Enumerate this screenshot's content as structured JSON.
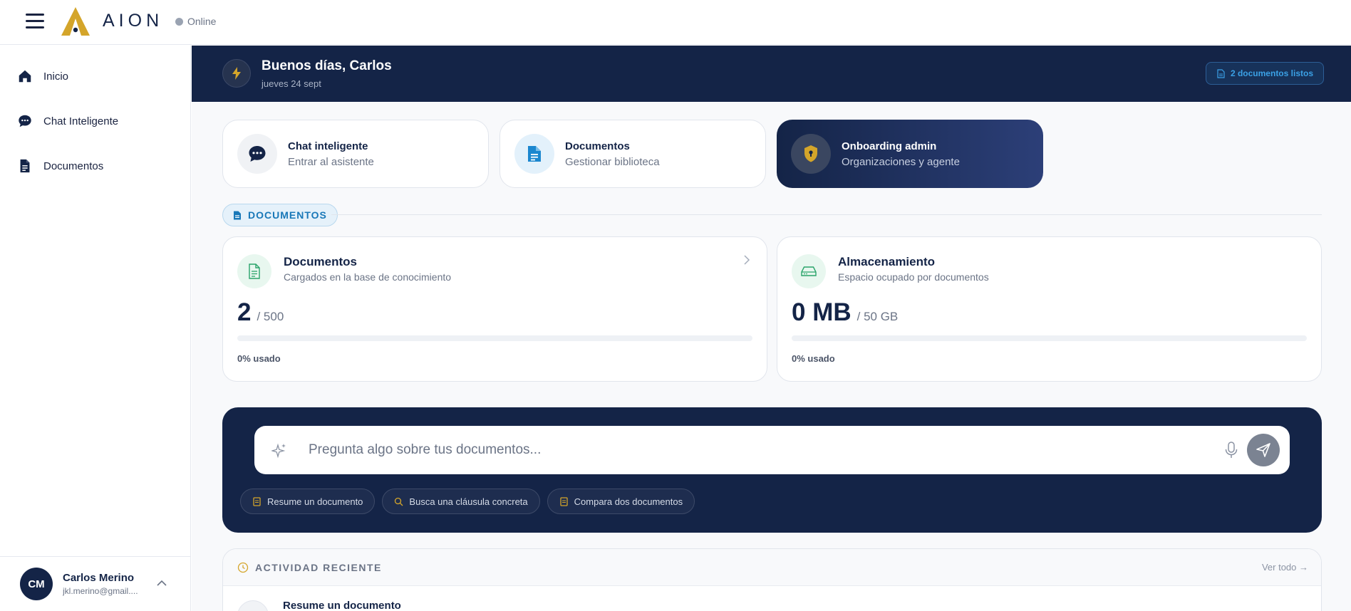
{
  "header": {
    "brand": "AION",
    "status": "Online"
  },
  "sidebar": {
    "items": [
      {
        "label": "Inicio",
        "icon": "home-icon"
      },
      {
        "label": "Chat Inteligente",
        "icon": "chat-icon"
      },
      {
        "label": "Documentos",
        "icon": "document-icon"
      }
    ],
    "user": {
      "initials": "CM",
      "name": "Carlos Merino",
      "email": "jkl.merino@gmail...."
    }
  },
  "hero": {
    "greeting": "Buenos días, Carlos",
    "date": "jueves 24 sept",
    "docs_ready": "2 documentos listos"
  },
  "quick_cards": [
    {
      "title": "Chat inteligente",
      "subtitle": "Entrar al asistente",
      "icon": "chat-bubble-icon"
    },
    {
      "title": "Documentos",
      "subtitle": "Gestionar biblioteca",
      "icon": "document-icon"
    },
    {
      "title": "Onboarding admin",
      "subtitle": "Organizaciones y agente",
      "icon": "shield-icon"
    }
  ],
  "section": {
    "label": "DOCUMENTOS"
  },
  "stats": [
    {
      "title": "Documentos",
      "subtitle": "Cargados en la base de conocimiento",
      "value": "2",
      "limit": "/ 500",
      "usage": "0% usado",
      "usage_fraction": 0,
      "icon": "file-icon"
    },
    {
      "title": "Almacenamiento",
      "subtitle": "Espacio ocupado por documentos",
      "value": "0 MB",
      "limit": "/ 50 GB",
      "usage": "0% usado",
      "usage_fraction": 0,
      "icon": "drive-icon"
    }
  ],
  "ask": {
    "placeholder": "Pregunta algo sobre tus documentos...",
    "suggestions": [
      "Resume un documento",
      "Busca una cláusula concreta",
      "Compara dos documentos"
    ]
  },
  "activity": {
    "title": "ACTIVIDAD RECIENTE",
    "see_all": "Ver todo →",
    "items": [
      {
        "title": "Resume un documento"
      }
    ]
  },
  "colors": {
    "navy": "#142447",
    "gold": "#d4a52a",
    "accent_blue": "#1978b8",
    "success": "#2aa46a"
  }
}
